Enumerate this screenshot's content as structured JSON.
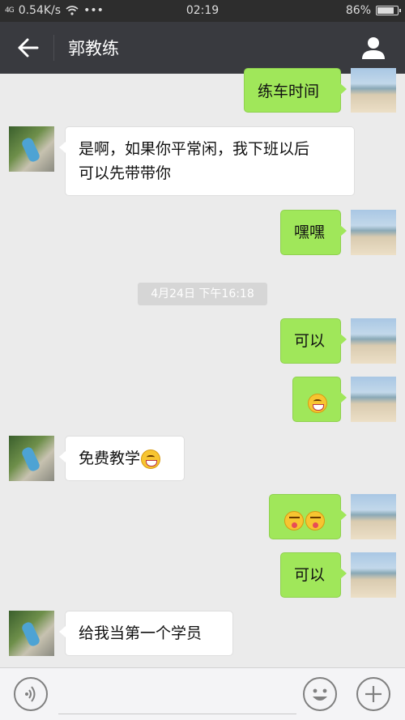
{
  "status_bar": {
    "network": "4G",
    "speed": "0.54K/s",
    "wifi_icon": "wifi-icon",
    "more": "•••",
    "time": "02:19",
    "battery_text": "86%",
    "battery_level": 0.86
  },
  "header": {
    "title": "郭教练",
    "back_icon": "arrow-left-icon",
    "profile_icon": "person-icon"
  },
  "messages": [
    {
      "side": "right",
      "text": "练车时间"
    },
    {
      "side": "left",
      "text_lines": [
        "是啊，如果你平常闲，我下班以后",
        "可以先带带你"
      ]
    },
    {
      "side": "right",
      "text": "嘿嘿"
    },
    {
      "timestamp": "4月24日 下午16:18"
    },
    {
      "side": "right",
      "text": "可以"
    },
    {
      "side": "right",
      "emoji": [
        "grinning-face"
      ]
    },
    {
      "side": "left",
      "text": "免费教学",
      "emoji": [
        "grinning-face"
      ]
    },
    {
      "side": "right",
      "emoji": [
        "winking-tongue-face",
        "winking-tongue-face"
      ]
    },
    {
      "side": "right",
      "text": "可以"
    },
    {
      "side": "left",
      "text": "给我当第一个学员"
    }
  ],
  "input_bar": {
    "voice_icon": "voice-icon",
    "emoji_icon": "smiley-icon",
    "plus_icon": "plus-icon",
    "input_value": ""
  },
  "colors": {
    "sent_bubble": "#a0e75a",
    "received_bubble": "#ffffff",
    "header_bg": "#393a3f",
    "chat_bg": "#ebebeb"
  }
}
